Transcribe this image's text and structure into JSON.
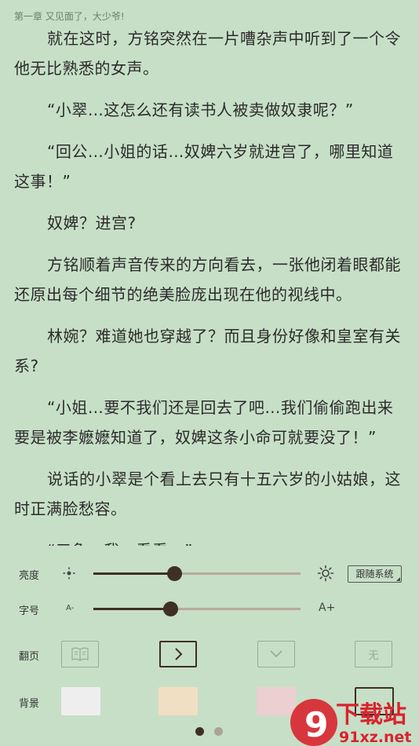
{
  "chapter_title": "第一章 又见面了，大少爷!",
  "paragraphs": [
    "就在这时，方铭突然在一片嘈杂声中听到了一个令他无比熟悉的女声。",
    "“小翠…这怎么还有读书人被卖做奴隶呢？”",
    "“回公…小姐的话…奴婢六岁就进宫了，哪里知道这事！”",
    "奴婢？进宫?",
    "方铭顺着声音传来的方向看去，一张他闭着眼都能还原出每个细节的绝美脸庞出现在他的视线中。",
    "林婉？难道她也穿越了？而且身份好像和皇室有关系?",
    "“小姐…要不我们还是回去了吧…我们偷偷跑出来要是被李嬷嬷知道了，奴婢这条小命可就要没了！”",
    "说话的小翠是个看上去只有十五六岁的小姑娘，这时正满脸愁容。",
    "“三象，我一看看…”"
  ],
  "settings": {
    "brightness": {
      "label": "亮度",
      "value_percent": 39,
      "follow_label": "跟随系统"
    },
    "font_size": {
      "label": "字号",
      "value_percent": 37,
      "small_label": "A-",
      "large_label": "A+"
    },
    "page_turn": {
      "label": "翻页",
      "none_label": "无",
      "selected": "slide"
    },
    "background": {
      "label": "背景",
      "swatches": [
        "#eeeeee",
        "#f1dfc3",
        "#eccfd0",
        "#c7dfc7"
      ],
      "selected_index": 3
    }
  },
  "pager": {
    "pages": 2,
    "current": 0
  },
  "watermark": {
    "logo_text": "9",
    "brand": "下载站",
    "domain": "91xz.net"
  },
  "colors": {
    "page_bg": "#c7dfc7",
    "accent": "#3f2f24",
    "track": "#b9a99a"
  }
}
